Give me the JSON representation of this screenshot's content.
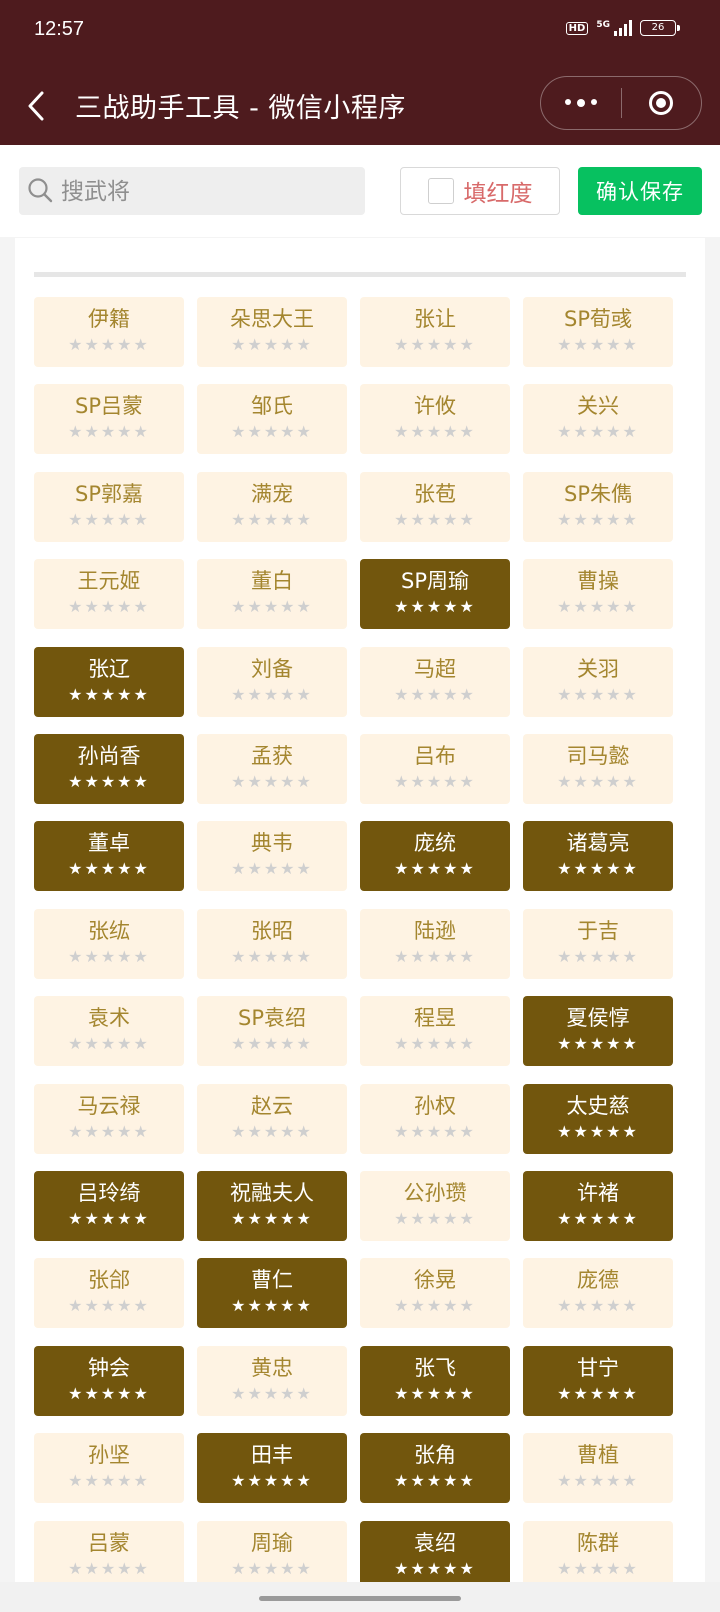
{
  "status_bar": {
    "time": "12:57",
    "hd": "HD",
    "network": "5G",
    "battery": "26"
  },
  "nav": {
    "title": "三战助手工具 - 微信小程序"
  },
  "toolbar": {
    "search_placeholder": "搜武将",
    "search_value": "",
    "fill_red_label": "填红度",
    "fill_red_checked": false,
    "save_label": "确认保存"
  },
  "colors": {
    "nav_bg": "#4e1b1e",
    "card_bg": "#fef3e3",
    "card_selected_bg": "#72560d",
    "card_text": "#a4862f",
    "save_green": "#07c160"
  },
  "stars_max": 5,
  "generals": [
    {
      "name": "伊籍",
      "selected": false,
      "stars_lit": 0
    },
    {
      "name": "朵思大王",
      "selected": false,
      "stars_lit": 0
    },
    {
      "name": "张让",
      "selected": false,
      "stars_lit": 0
    },
    {
      "name": "SP荀彧",
      "selected": false,
      "stars_lit": 0
    },
    {
      "name": "SP吕蒙",
      "selected": false,
      "stars_lit": 0
    },
    {
      "name": "邹氏",
      "selected": false,
      "stars_lit": 0
    },
    {
      "name": "许攸",
      "selected": false,
      "stars_lit": 0
    },
    {
      "name": "关兴",
      "selected": false,
      "stars_lit": 0
    },
    {
      "name": "SP郭嘉",
      "selected": false,
      "stars_lit": 0
    },
    {
      "name": "满宠",
      "selected": false,
      "stars_lit": 0
    },
    {
      "name": "张苞",
      "selected": false,
      "stars_lit": 0
    },
    {
      "name": "SP朱儁",
      "selected": false,
      "stars_lit": 0
    },
    {
      "name": "王元姬",
      "selected": false,
      "stars_lit": 0
    },
    {
      "name": "董白",
      "selected": false,
      "stars_lit": 0
    },
    {
      "name": "SP周瑜",
      "selected": true,
      "stars_lit": 5
    },
    {
      "name": "曹操",
      "selected": false,
      "stars_lit": 0
    },
    {
      "name": "张辽",
      "selected": true,
      "stars_lit": 5
    },
    {
      "name": "刘备",
      "selected": false,
      "stars_lit": 0
    },
    {
      "name": "马超",
      "selected": false,
      "stars_lit": 0
    },
    {
      "name": "关羽",
      "selected": false,
      "stars_lit": 0
    },
    {
      "name": "孙尚香",
      "selected": true,
      "stars_lit": 5
    },
    {
      "name": "孟获",
      "selected": false,
      "stars_lit": 0
    },
    {
      "name": "吕布",
      "selected": false,
      "stars_lit": 0
    },
    {
      "name": "司马懿",
      "selected": false,
      "stars_lit": 0
    },
    {
      "name": "董卓",
      "selected": true,
      "stars_lit": 5
    },
    {
      "name": "典韦",
      "selected": false,
      "stars_lit": 0
    },
    {
      "name": "庞统",
      "selected": true,
      "stars_lit": 5
    },
    {
      "name": "诸葛亮",
      "selected": true,
      "stars_lit": 5
    },
    {
      "name": "张纮",
      "selected": false,
      "stars_lit": 0
    },
    {
      "name": "张昭",
      "selected": false,
      "stars_lit": 0
    },
    {
      "name": "陆逊",
      "selected": false,
      "stars_lit": 0
    },
    {
      "name": "于吉",
      "selected": false,
      "stars_lit": 0
    },
    {
      "name": "袁术",
      "selected": false,
      "stars_lit": 0
    },
    {
      "name": "SP袁绍",
      "selected": false,
      "stars_lit": 0
    },
    {
      "name": "程昱",
      "selected": false,
      "stars_lit": 0
    },
    {
      "name": "夏侯惇",
      "selected": true,
      "stars_lit": 5
    },
    {
      "name": "马云禄",
      "selected": false,
      "stars_lit": 0
    },
    {
      "name": "赵云",
      "selected": false,
      "stars_lit": 0
    },
    {
      "name": "孙权",
      "selected": false,
      "stars_lit": 0
    },
    {
      "name": "太史慈",
      "selected": true,
      "stars_lit": 5
    },
    {
      "name": "吕玲绮",
      "selected": true,
      "stars_lit": 5
    },
    {
      "name": "祝融夫人",
      "selected": true,
      "stars_lit": 5
    },
    {
      "name": "公孙瓒",
      "selected": false,
      "stars_lit": 0
    },
    {
      "name": "许褚",
      "selected": true,
      "stars_lit": 5
    },
    {
      "name": "张郃",
      "selected": false,
      "stars_lit": 0
    },
    {
      "name": "曹仁",
      "selected": true,
      "stars_lit": 5
    },
    {
      "name": "徐晃",
      "selected": false,
      "stars_lit": 0
    },
    {
      "name": "庞德",
      "selected": false,
      "stars_lit": 0
    },
    {
      "name": "钟会",
      "selected": true,
      "stars_lit": 5
    },
    {
      "name": "黄忠",
      "selected": false,
      "stars_lit": 0
    },
    {
      "name": "张飞",
      "selected": true,
      "stars_lit": 5
    },
    {
      "name": "甘宁",
      "selected": true,
      "stars_lit": 5
    },
    {
      "name": "孙坚",
      "selected": false,
      "stars_lit": 0
    },
    {
      "name": "田丰",
      "selected": true,
      "stars_lit": 5
    },
    {
      "name": "张角",
      "selected": true,
      "stars_lit": 5
    },
    {
      "name": "曹植",
      "selected": false,
      "stars_lit": 0
    },
    {
      "name": "吕蒙",
      "selected": false,
      "stars_lit": 0
    },
    {
      "name": "周瑜",
      "selected": false,
      "stars_lit": 0
    },
    {
      "name": "袁绍",
      "selected": true,
      "stars_lit": 5
    },
    {
      "name": "陈群",
      "selected": false,
      "stars_lit": 0
    }
  ]
}
